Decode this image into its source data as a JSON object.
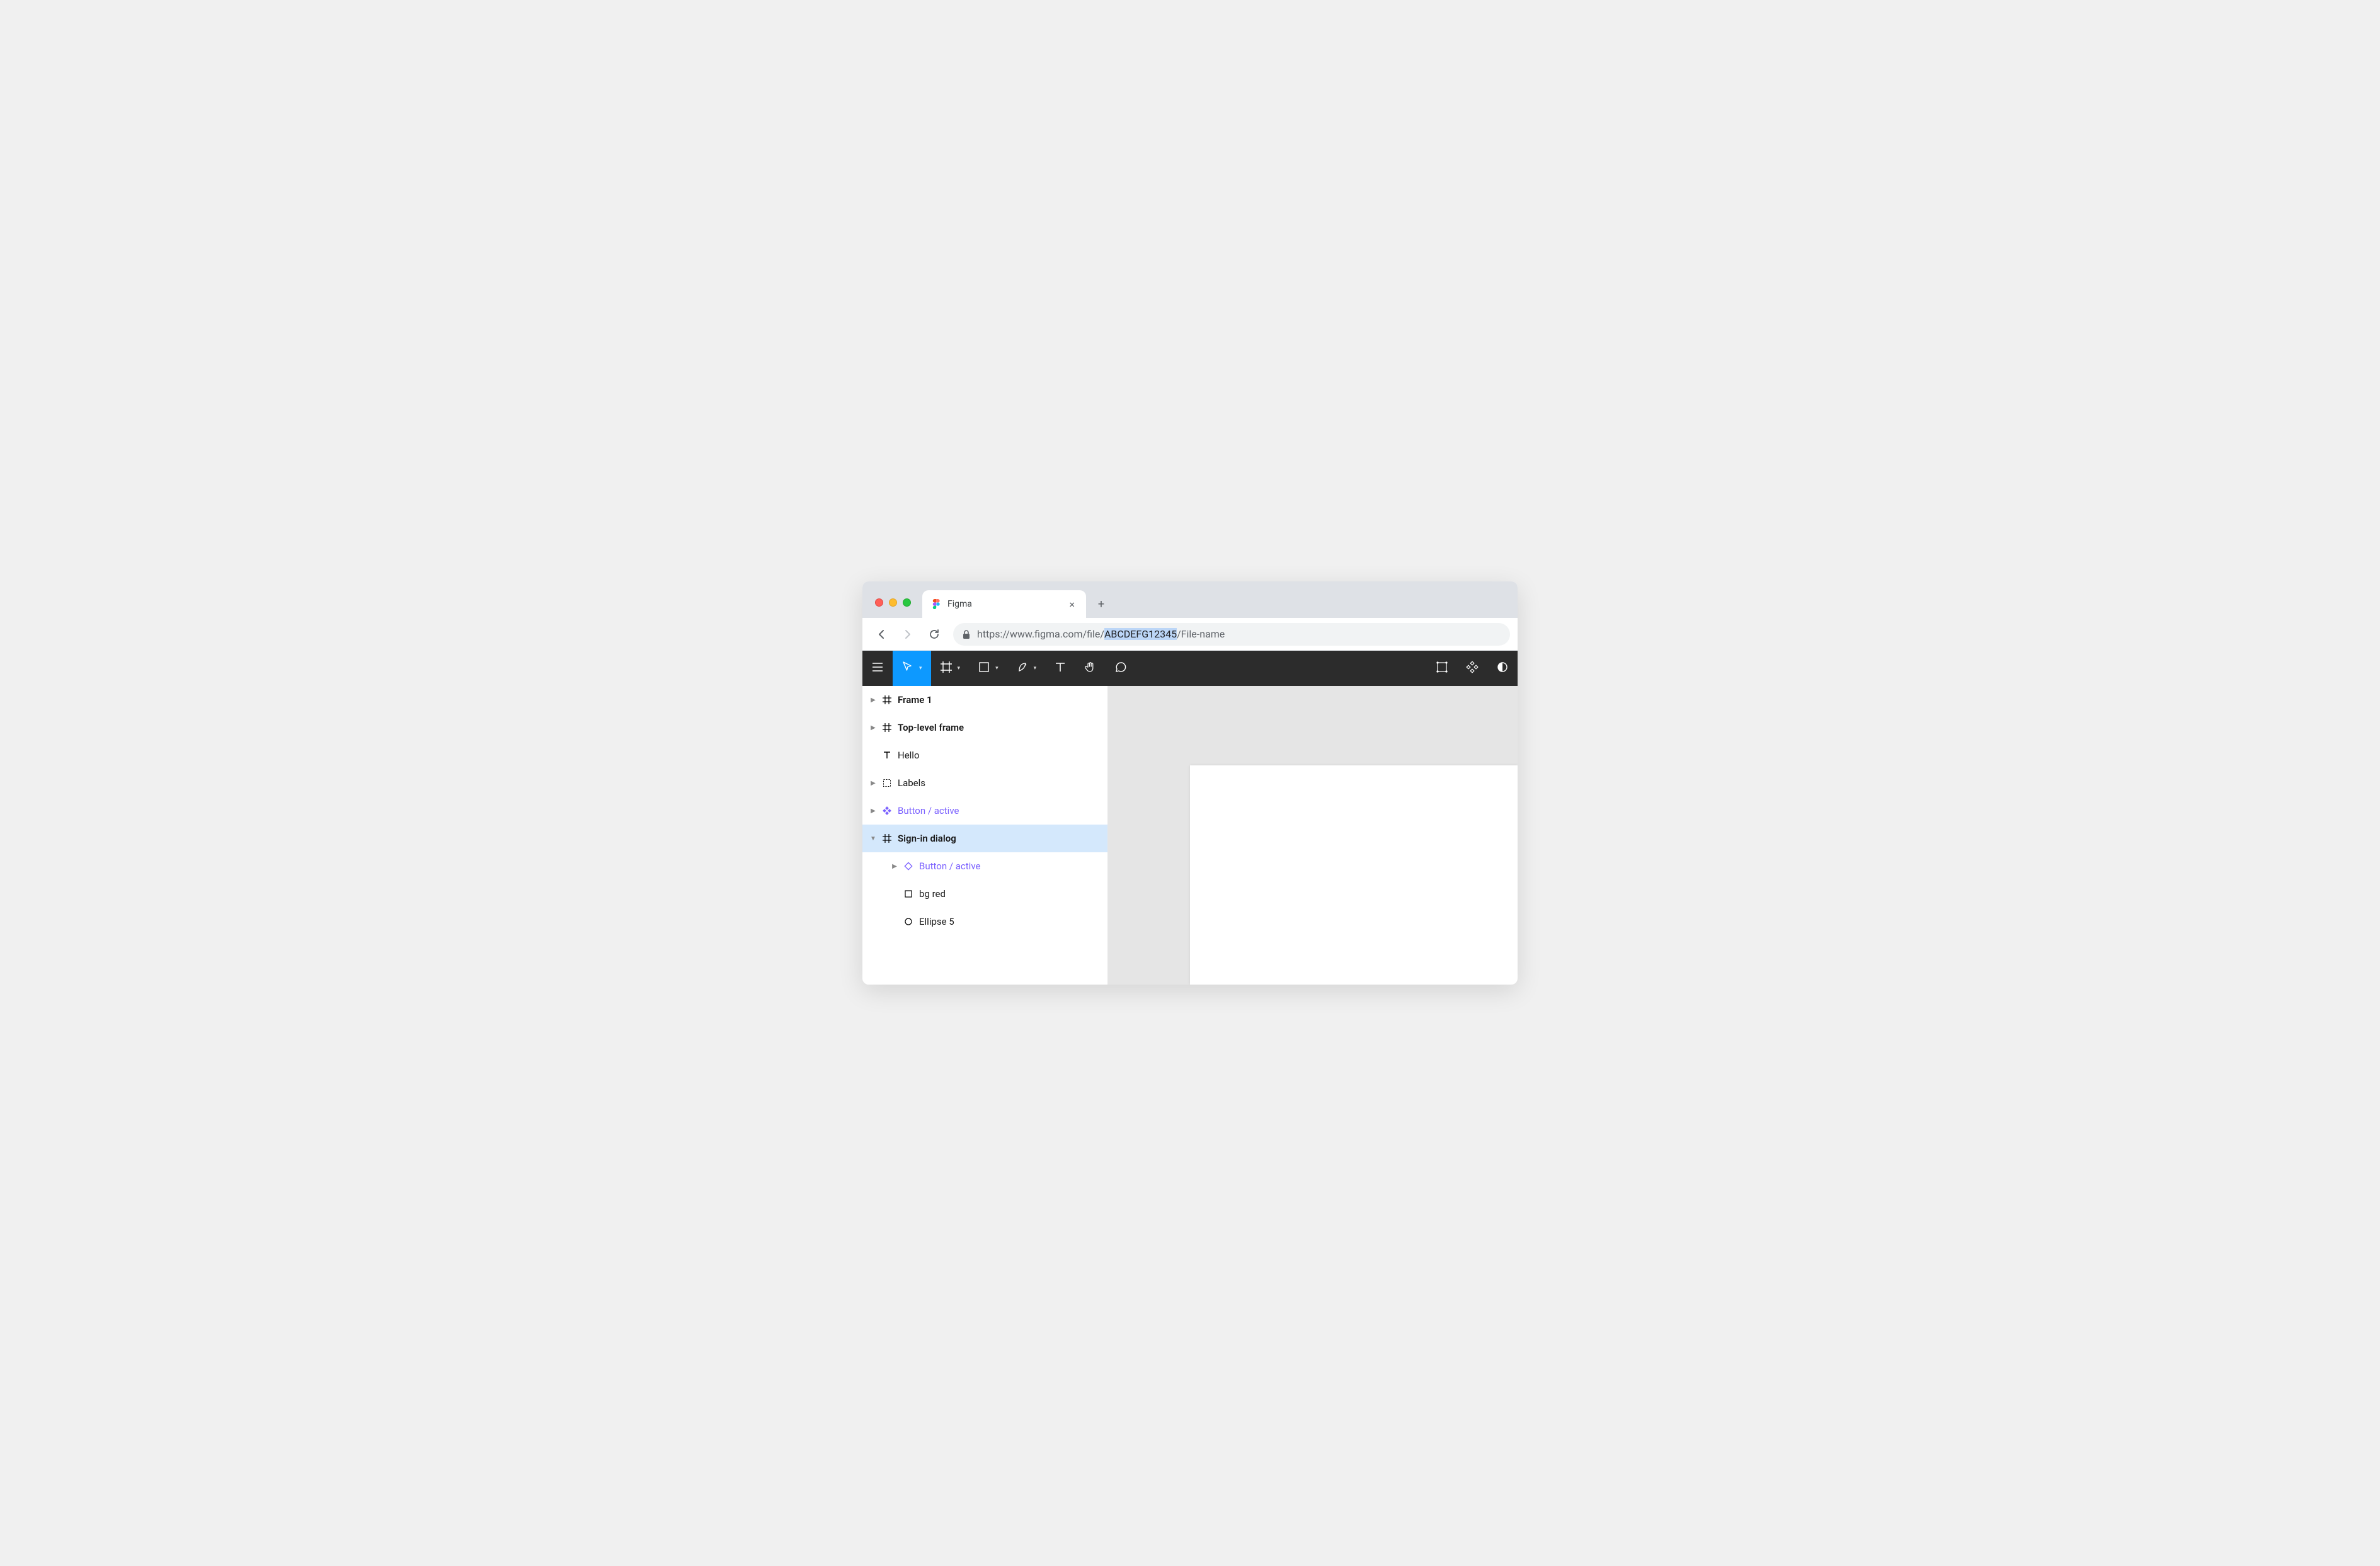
{
  "browser": {
    "tab_title": "Figma",
    "url_prefix": "https://www.figma.com/file/",
    "url_file_id": "ABCDEFG12345",
    "url_suffix": "/File-name",
    "close_glyph": "×",
    "newtab_glyph": "+"
  },
  "toolbar": {
    "items": [
      {
        "name": "menu",
        "active": false,
        "has_caret": false
      },
      {
        "name": "move",
        "active": true,
        "has_caret": true
      },
      {
        "name": "frame",
        "active": false,
        "has_caret": true
      },
      {
        "name": "shape",
        "active": false,
        "has_caret": true
      },
      {
        "name": "pen",
        "active": false,
        "has_caret": true
      },
      {
        "name": "text",
        "active": false,
        "has_caret": false
      },
      {
        "name": "hand",
        "active": false,
        "has_caret": false
      },
      {
        "name": "comment",
        "active": false,
        "has_caret": false
      }
    ],
    "right_items": [
      {
        "name": "group-selection"
      },
      {
        "name": "components"
      },
      {
        "name": "mask"
      }
    ]
  },
  "layers": [
    {
      "label": "Frame 1",
      "icon": "frame",
      "indent": 0,
      "bold": true,
      "chevron": "closed",
      "selected": false,
      "component": false
    },
    {
      "label": "Top-level frame",
      "icon": "frame",
      "indent": 0,
      "bold": true,
      "chevron": "closed",
      "selected": false,
      "component": false
    },
    {
      "label": "Hello",
      "icon": "text",
      "indent": 0,
      "bold": false,
      "chevron": "none",
      "selected": false,
      "component": false
    },
    {
      "label": "Labels",
      "icon": "group",
      "indent": 0,
      "bold": false,
      "chevron": "closed",
      "selected": false,
      "component": false
    },
    {
      "label": "Button / active",
      "icon": "component",
      "indent": 0,
      "bold": false,
      "chevron": "closed",
      "selected": false,
      "component": true
    },
    {
      "label": "Sign-in dialog",
      "icon": "frame",
      "indent": 0,
      "bold": true,
      "chevron": "open",
      "selected": true,
      "component": false
    },
    {
      "label": "Button / active",
      "icon": "instance",
      "indent": 1,
      "bold": false,
      "chevron": "closed",
      "selected": false,
      "component": true
    },
    {
      "label": "bg red",
      "icon": "rect",
      "indent": 1,
      "bold": false,
      "chevron": "none",
      "selected": false,
      "component": false
    },
    {
      "label": "Ellipse 5",
      "icon": "ellipse",
      "indent": 1,
      "bold": false,
      "chevron": "none",
      "selected": false,
      "component": false
    }
  ]
}
